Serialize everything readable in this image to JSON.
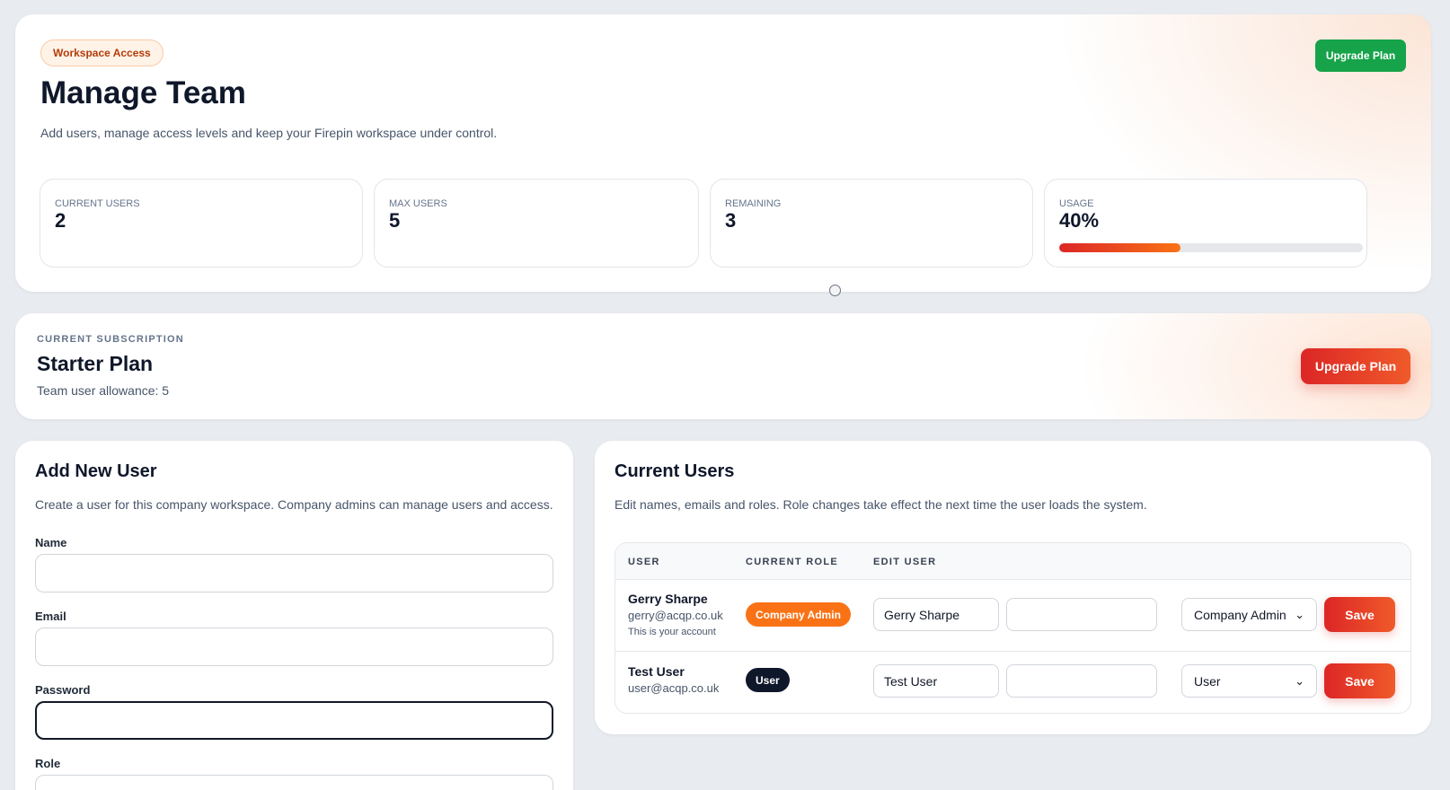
{
  "hero": {
    "badge": "Workspace Access",
    "title": "Manage Team",
    "subtitle": "Add users, manage access levels and keep your Firepin workspace under control.",
    "upgrade_label": "Upgrade Plan",
    "stats": [
      {
        "label": "CURRENT USERS",
        "value": "2"
      },
      {
        "label": "MAX USERS",
        "value": "5"
      },
      {
        "label": "REMAINING",
        "value": "3"
      },
      {
        "label": "USAGE",
        "value": "40%"
      }
    ],
    "usage_fraction": 0.4
  },
  "subscription": {
    "kicker": "CURRENT SUBSCRIPTION",
    "plan": "Starter Plan",
    "allowance": "Team user allowance: 5",
    "upgrade_label": "Upgrade Plan"
  },
  "add_user": {
    "title": "Add New User",
    "description": "Create a user for this company workspace. Company admins can manage users and access.",
    "name_label": "Name",
    "email_label": "Email",
    "password_label": "Password",
    "role_label": "Role"
  },
  "current_users": {
    "title": "Current Users",
    "description": "Edit names, emails and roles. Role changes take effect the next time the user loads the system.",
    "columns": [
      "USER",
      "CURRENT ROLE",
      "EDIT USER"
    ],
    "rows": [
      {
        "name": "Gerry Sharpe",
        "email": "gerry@acqp.co.uk",
        "note": "This is your account",
        "role_badge": "Company Admin",
        "edit_name": "Gerry Sharpe",
        "edit_email": "",
        "edit_role": "Company Admin",
        "save_label": "Save"
      },
      {
        "name": "Test User",
        "email": "user@acqp.co.uk",
        "role_badge": "User",
        "edit_name": "Test User",
        "edit_email": "",
        "edit_role": "User",
        "save_label": "Save"
      }
    ]
  },
  "colors": {
    "accent_orange": "#f97316",
    "accent_red": "#dc2626",
    "success_green": "#16a34a",
    "dark_badge": "#0f172a",
    "page_bg": "#e8ebef"
  }
}
